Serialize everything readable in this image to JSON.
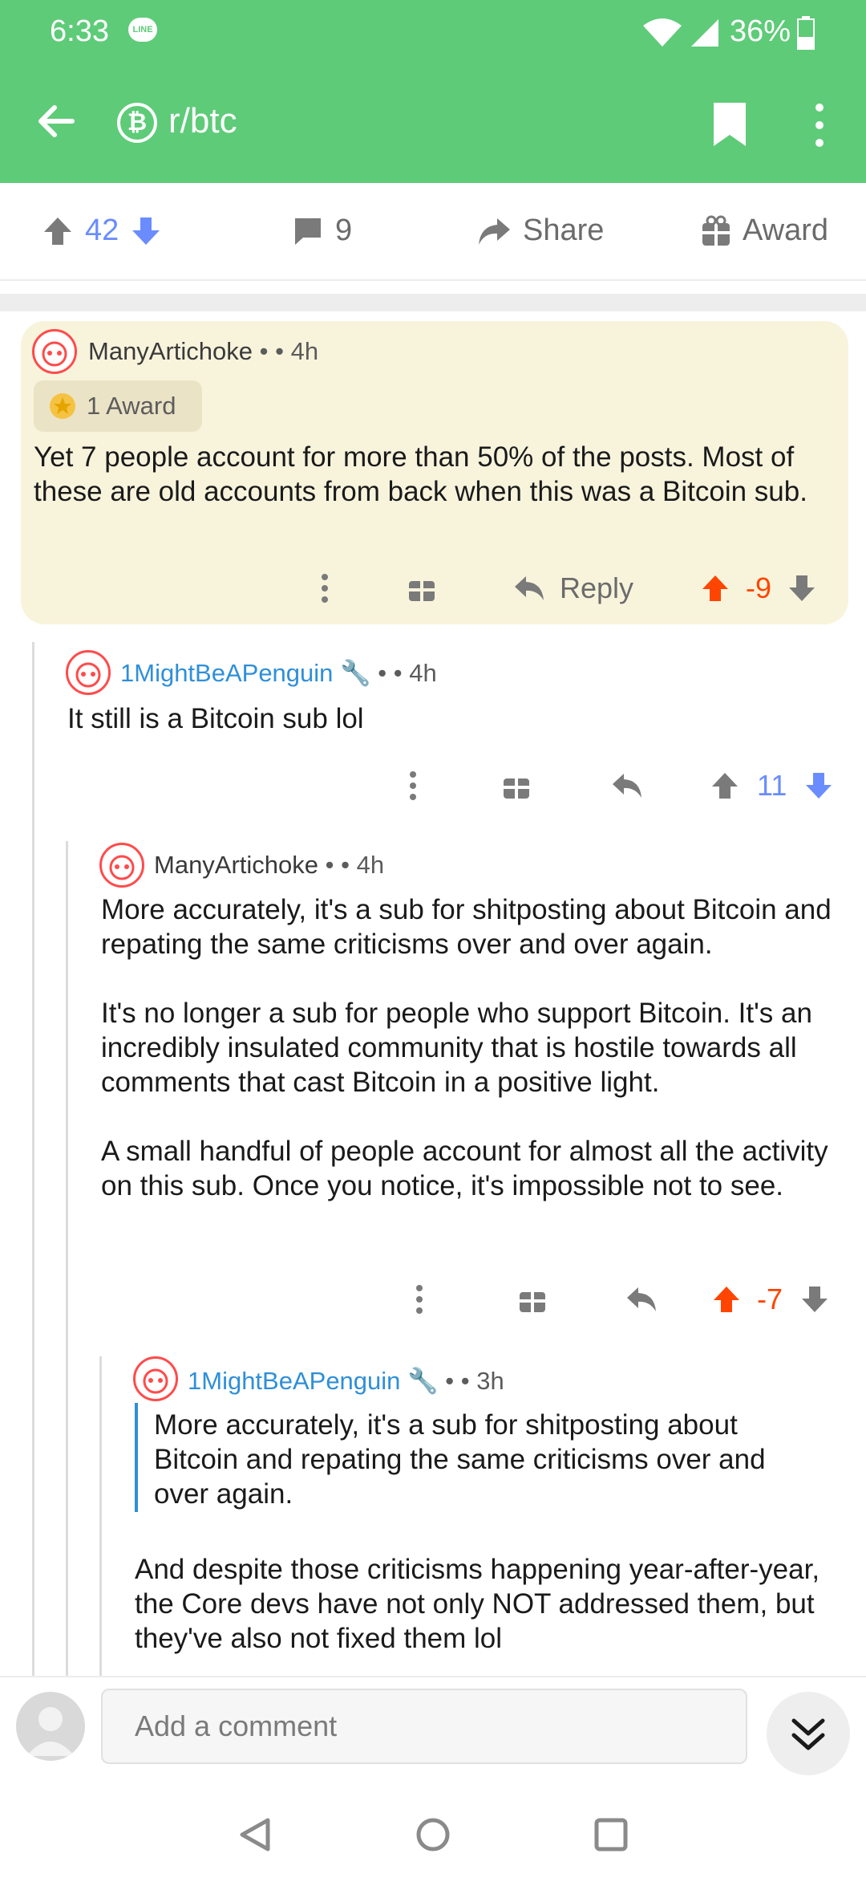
{
  "status": {
    "time": "6:33",
    "line_badge": "LINE",
    "battery": "36%"
  },
  "app_bar": {
    "subreddit": "r/btc",
    "subreddit_icon": "₿"
  },
  "post_actions": {
    "upvotes": "42",
    "comments": "9",
    "share": "Share",
    "award": "Award"
  },
  "comments": [
    {
      "user": "ManyArtichoke",
      "dot": "•",
      "age": "• 4h",
      "award": "1 Award",
      "body": "Yet 7 people account for more than 50% of the posts. Most of these are old accounts from back when this was a Bitcoin sub.",
      "reply": "Reply",
      "score": "-9"
    },
    {
      "user": "1MightBeAPenguin",
      "dot": "•",
      "age": "• 4h",
      "body": "It still is a Bitcoin sub lol",
      "score": "11"
    },
    {
      "user": "ManyArtichoke",
      "dot": "•",
      "age": "• 4h",
      "paragraphs": [
        "More accurately, it's a sub for shitposting about Bitcoin and repating the same criticisms over and over again.",
        "It's no longer a sub for people who support Bitcoin. It's an incredibly insulated community that is hostile towards all comments that cast Bitcoin in a positive light.",
        "A small handful of people account for almost all the activity on this sub. Once you notice, it's impossible not to see."
      ],
      "score": "-7"
    },
    {
      "user": "1MightBeAPenguin",
      "dot": "•",
      "age": "• 3h",
      "quote": "More accurately, it's a sub for shitposting about Bitcoin and repating the same criticisms over and over again.",
      "body": "And despite those criticisms happening year-after-year, the Core devs have not only NOT addressed them, but they've also not fixed them lol"
    }
  ],
  "comment_input": {
    "placeholder": "Add a comment"
  },
  "colors": {
    "green": "#5ecb78",
    "upvote_orange": "#ff4500",
    "downvote_blue": "#6a8cff",
    "username_blue": "#2f8fd8"
  }
}
